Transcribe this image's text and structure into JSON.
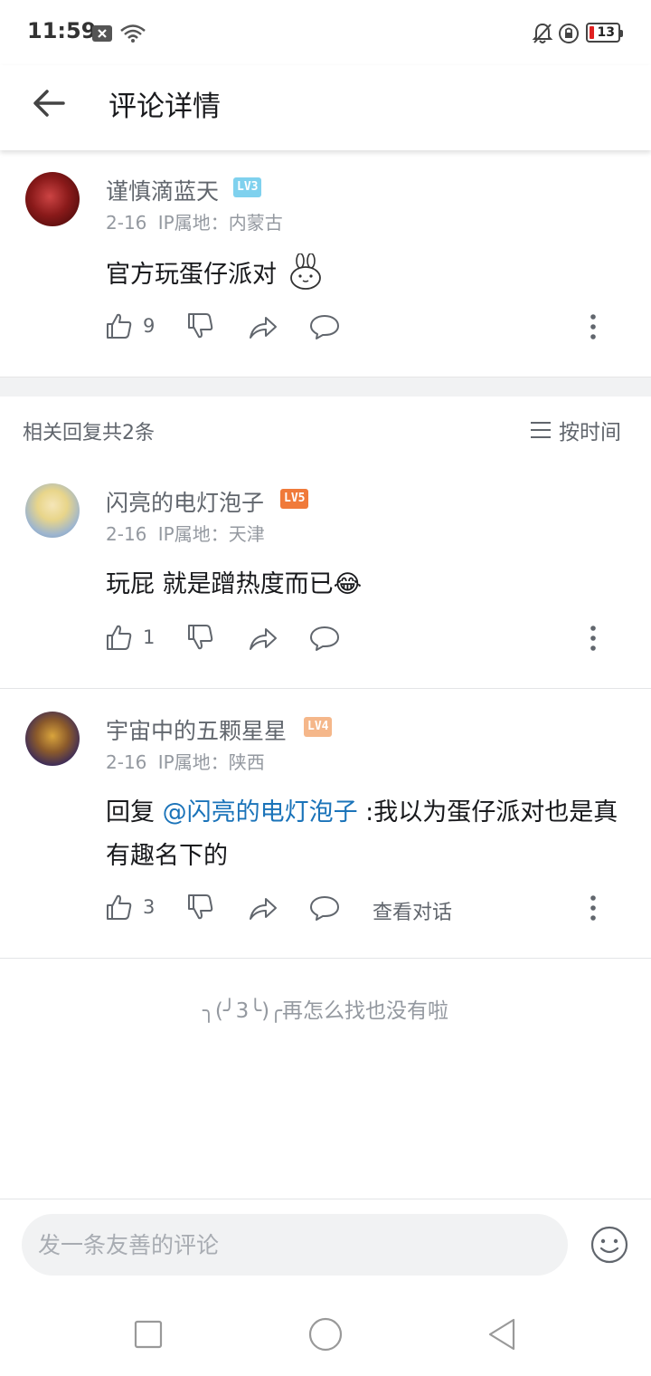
{
  "status_bar": {
    "time": "11:59",
    "battery": "13"
  },
  "header": {
    "title": "评论详情"
  },
  "root_comment": {
    "username": "谨慎滴蓝天",
    "level": "LV3",
    "level_color": "#7fd1ee",
    "date": "2-16",
    "ip_label": "IP属地：内蒙古",
    "content": "官方玩蛋仔派对",
    "content_emoji": "bunny-sticker",
    "likes": "9"
  },
  "replies_section": {
    "title": "相关回复共2条",
    "sort_label": "按时间"
  },
  "replies": [
    {
      "username": "闪亮的电灯泡子",
      "level": "LV5",
      "level_color": "#f07a3a",
      "date": "2-16",
      "ip_label": "IP属地：天津",
      "content": "玩屁 就是蹭热度而已",
      "content_emoji": "😂",
      "likes": "1"
    },
    {
      "username": "宇宙中的五颗星星",
      "level": "LV4",
      "level_color": "#f5b78a",
      "date": "2-16",
      "ip_label": "IP属地：陕西",
      "reply_prefix": "回复 ",
      "mention": "@闪亮的电灯泡子",
      "content": " :我以为蛋仔派对也是真有趣名下的",
      "likes": "3",
      "view_conversation": "查看对话"
    }
  ],
  "end_message": "╮(╯3╰)╭再怎么找也没有啦",
  "input": {
    "placeholder": "发一条友善的评论"
  },
  "colors": {
    "accent": "#1a73b9",
    "text_secondary": "#61666d",
    "text_muted": "#9499a0"
  }
}
